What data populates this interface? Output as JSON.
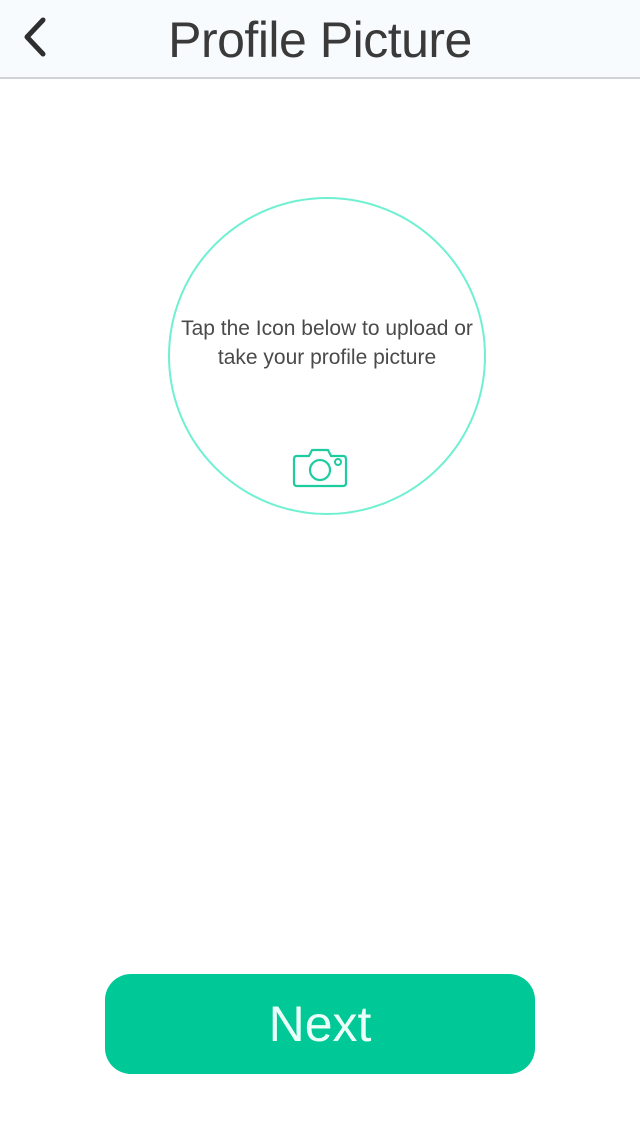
{
  "header": {
    "title": "Profile Picture",
    "back_icon": "chevron-left-icon"
  },
  "upload": {
    "instruction": "Tap the Icon below to upload or take your profile picture",
    "camera_icon": "camera-icon"
  },
  "footer": {
    "next_label": "Next"
  },
  "colors": {
    "accent": "#00c896",
    "circle_border": "#6ff0d2",
    "camera_icon": "#1fcca0",
    "nav_background": "#f8fbfd"
  }
}
